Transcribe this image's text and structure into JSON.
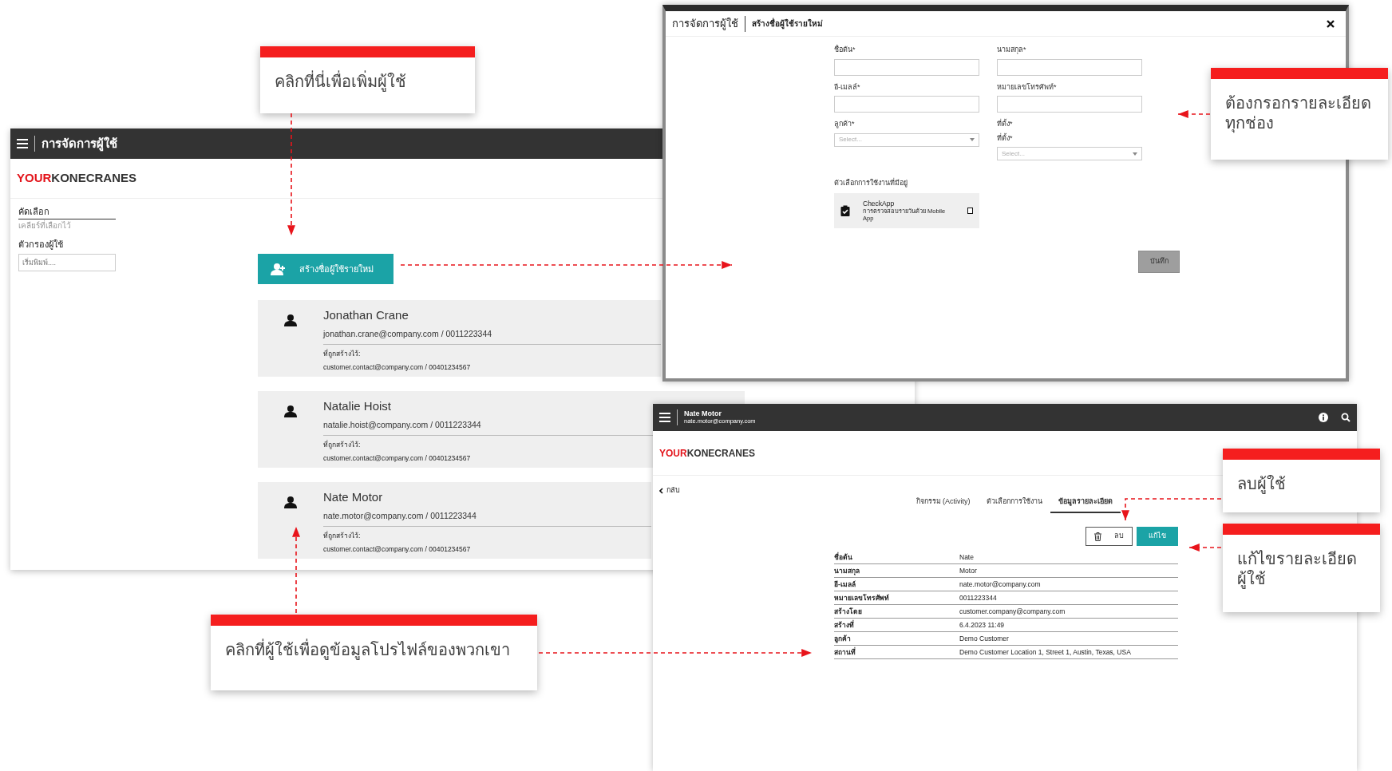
{
  "user_list_screen": {
    "header_title": "การจัดการผู้ใช้",
    "logo": {
      "accent": "YOUR",
      "main": "KONECRANES"
    },
    "sidebar": {
      "sort_label": "คัดเลือก",
      "clear_link": "เคลียร์ที่เลือกไว้",
      "filter_label": "ตัวกรองผู้ใช้",
      "filter_placeholder": "เริ่มพิมพ์...."
    },
    "create_button": "สร้างชื่อผู้ใช้รายใหม่",
    "users": [
      {
        "name": "Jonathan Crane",
        "contact": "jonathan.crane@company.com / 0011223344",
        "created_by_label": "ที่ถูกสร้างไว้:",
        "created_by": "customer.contact@company.com / 00401234567"
      },
      {
        "name": "Natalie Hoist",
        "contact": "natalie.hoist@company.com / 0011223344",
        "created_by_label": "ที่ถูกสร้างไว้:",
        "created_by": "customer.contact@company.com / 00401234567"
      },
      {
        "name": "Nate Motor",
        "contact": "nate.motor@company.com / 0011223344",
        "created_by_label": "ที่ถูกสร้างไว้:",
        "created_by": "customer.contact@company.com / 00401234567"
      }
    ]
  },
  "create_user_dialog": {
    "title": "การจัดการผู้ใช้",
    "subtitle": "สร้างชื่อผู้ใช้รายใหม่",
    "fields": [
      {
        "kind": "text",
        "labels": [
          "ชื่อต้น*"
        ]
      },
      {
        "kind": "text",
        "labels": [
          "นามสกุล*"
        ]
      },
      {
        "kind": "text",
        "labels": [
          "อี-เมลล์*"
        ]
      },
      {
        "kind": "text",
        "labels": [
          "หมายเลขโทรศัพท์*"
        ]
      },
      {
        "kind": "select",
        "labels": [
          "ลูกค้า*"
        ],
        "placeholder": "Select..."
      },
      {
        "kind": "select",
        "labels": [
          "ที่ตั้ง*",
          "ที่ตั้ง*"
        ],
        "placeholder": "Select..."
      }
    ],
    "options_label": "ตัวเลือกการใช้งานที่มีอยู่",
    "app_option": {
      "name": "CheckApp",
      "description": "การตรวจสอบรายวันด้วย Mobile App",
      "checked": false
    },
    "save_button": "บันทึก"
  },
  "user_detail_screen": {
    "user_name": "Nate Motor",
    "user_email": "nate.motor@company.com",
    "logo": {
      "accent": "YOUR",
      "main": "KONECRANES"
    },
    "back_link": "กลับ",
    "tabs": [
      {
        "label": "กิจกรรม (Activity)",
        "selected": false
      },
      {
        "label": "ตัวเลือกการใช้งาน",
        "selected": false
      },
      {
        "label": "ข้อมูลรายละเอียด",
        "selected": true
      }
    ],
    "delete_button": "ลบ",
    "edit_button": "แก้ไข",
    "details": [
      {
        "label": "ชื่อต้น",
        "value": "Nate"
      },
      {
        "label": "นามสกุล",
        "value": "Motor"
      },
      {
        "label": "อี-เมลล์",
        "value": "nate.motor@company.com"
      },
      {
        "label": "หมายเลขโทรศัพท์",
        "value": "0011223344"
      },
      {
        "label": "สร้างโดย",
        "value": "customer.company@company.com"
      },
      {
        "label": "สร้างที่",
        "value": "6.4.2023 11:49"
      },
      {
        "label": "ลูกค้า",
        "value": "Demo Customer"
      },
      {
        "label": "สถานที่",
        "value": "Demo Customer Location 1, Street 1, Austin, Texas, USA"
      }
    ]
  },
  "callouts": [
    {
      "text": "คลิกที่นี่เพื่อเพิ่มผู้ใช้"
    },
    {
      "text": "ต้องกรอกรายละเอียดทุกช่อง"
    },
    {
      "text": "ลบผู้ใช้"
    },
    {
      "text": "แก้ไขรายละเอียดผู้ใช้"
    },
    {
      "text": "คลิกที่ผู้ใช้เพื่อดูข้อมูลโปรไฟล์ของพวกเขา"
    }
  ]
}
